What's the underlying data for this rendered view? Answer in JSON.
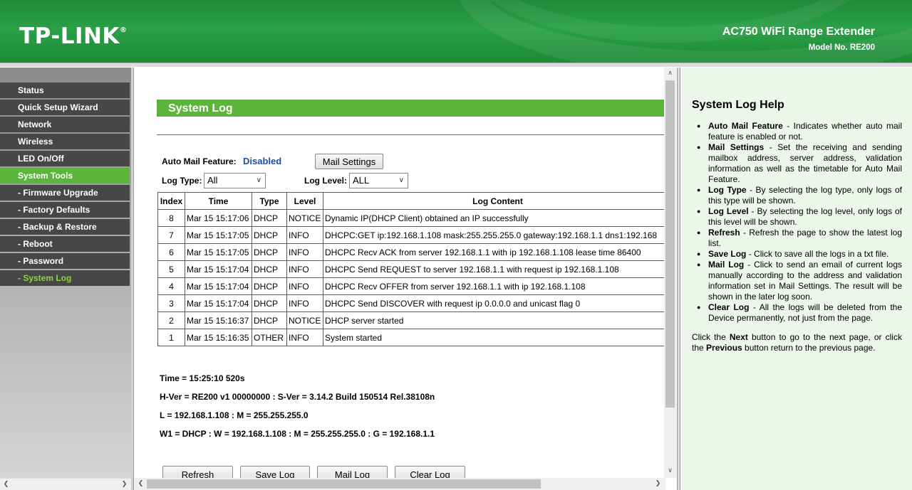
{
  "header": {
    "logo": "TP-LINK",
    "product": "AC750 WiFi Range Extender",
    "model": "Model No. RE200"
  },
  "sidebar": {
    "items": [
      {
        "label": "Status"
      },
      {
        "label": "Quick Setup Wizard"
      },
      {
        "label": "Network"
      },
      {
        "label": "Wireless"
      },
      {
        "label": "LED On/Off"
      },
      {
        "label": "System Tools"
      },
      {
        "label": "- Firmware Upgrade"
      },
      {
        "label": "- Factory Defaults"
      },
      {
        "label": "- Backup & Restore"
      },
      {
        "label": "- Reboot"
      },
      {
        "label": "- Password"
      },
      {
        "label": "- System Log"
      }
    ]
  },
  "main": {
    "title": "System Log",
    "auto_mail_label": "Auto Mail Feature:",
    "auto_mail_value": "Disabled",
    "mail_settings_button": "Mail Settings",
    "log_type_label": "Log Type:",
    "log_type_value": "All",
    "log_level_label": "Log Level:",
    "log_level_value": "ALL",
    "table": {
      "headers": [
        "Index",
        "Time",
        "Type",
        "Level",
        "Log Content"
      ],
      "rows": [
        [
          "8",
          "Mar 15 15:17:06",
          "DHCP",
          "NOTICE",
          "Dynamic IP(DHCP Client) obtained an IP successfully"
        ],
        [
          "7",
          "Mar 15 15:17:05",
          "DHCP",
          "INFO",
          "DHCPC:GET ip:192.168.1.108 mask:255.255.255.0 gateway:192.168.1.1 dns1:192.168"
        ],
        [
          "6",
          "Mar 15 15:17:05",
          "DHCP",
          "INFO",
          "DHCPC Recv ACK from server 192.168.1.1 with ip 192.168.1.108 lease time 86400"
        ],
        [
          "5",
          "Mar 15 15:17:04",
          "DHCP",
          "INFO",
          "DHCPC Send REQUEST to server 192.168.1.1 with request ip 192.168.1.108"
        ],
        [
          "4",
          "Mar 15 15:17:04",
          "DHCP",
          "INFO",
          "DHCPC Recv OFFER from server 192.168.1.1 with ip 192.168.1.108"
        ],
        [
          "3",
          "Mar 15 15:17:04",
          "DHCP",
          "INFO",
          "DHCPC Send DISCOVER with request ip 0.0.0.0 and unicast flag 0"
        ],
        [
          "2",
          "Mar 15 15:16:37",
          "DHCP",
          "NOTICE",
          "DHCP server started"
        ],
        [
          "1",
          "Mar 15 15:16:35",
          "OTHER",
          "INFO",
          "System started"
        ]
      ]
    },
    "info_lines": [
      "Time = 15:25:10 520s",
      "H-Ver = RE200 v1 00000000 : S-Ver = 3.14.2 Build 150514 Rel.38108n",
      "L = 192.168.1.108 : M = 255.255.255.0",
      "W1 = DHCP : W = 192.168.1.108 : M = 255.255.255.0 : G = 192.168.1.1"
    ],
    "buttons": {
      "refresh": "Refresh",
      "save_log": "Save Log",
      "mail_log": "Mail Log",
      "clear_log": "Clear Log"
    }
  },
  "help": {
    "title": "System Log Help",
    "items": [
      {
        "term": "Auto Mail Feature",
        "text": " - Indicates whether auto mail feature is enabled or not."
      },
      {
        "term": "Mail Settings",
        "text": " - Set the receiving and sending mailbox address, server address, validation information as well as the timetable for Auto Mail Feature."
      },
      {
        "term": "Log Type",
        "text": " - By selecting the log type, only logs of this type will be shown."
      },
      {
        "term": "Log Level",
        "text": " - By selecting the log level, only logs of this level will be shown."
      },
      {
        "term": "Refresh",
        "text": " - Refresh the page to show the latest log list."
      },
      {
        "term": "Save Log",
        "text": " - Click to save all the logs in a txt file."
      },
      {
        "term": "Mail Log",
        "text": " - Click to send an email of current logs manually according to the address and validation information set in Mail Settings. The result will be shown in the later log soon."
      },
      {
        "term": "Clear Log",
        "text": " - All the logs will be deleted from the Device permanently, not just from the page."
      }
    ],
    "footer": {
      "t1": "Click the ",
      "b1": "Next",
      "t2": " button to go to the next page, or click the ",
      "b2": "Previous",
      "t3": " button return to the previous page."
    }
  },
  "colors": {
    "brand_green": "#2aa047",
    "accent_green": "#5bb53a",
    "menu_bg": "#474747",
    "link_blue": "#1f4e9c",
    "help_bg": "#edf6ea"
  }
}
